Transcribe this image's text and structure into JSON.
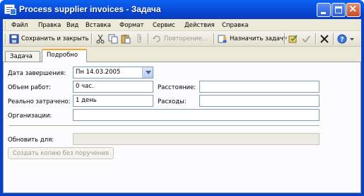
{
  "window": {
    "title": "Process supplier invoices - Задача"
  },
  "menu": [
    {
      "label": "Файл",
      "icon": ""
    },
    {
      "label": "Правка"
    },
    {
      "label": "Вид"
    },
    {
      "label": "Вставка"
    },
    {
      "label": "Формат"
    },
    {
      "label": "Сервис"
    },
    {
      "label": "Действия"
    },
    {
      "label": "Справка"
    }
  ],
  "toolbar": {
    "save_close": "Сохранить и закрыть",
    "recurrence": "Повторение...",
    "assign_task": "Назначить задачу",
    "icons": [
      "save-icon",
      "cut-icon",
      "copy-icon",
      "paste-icon",
      "paperclip-icon",
      "recurrence-icon",
      "assign-task-icon",
      "task-status-icon",
      "mark-complete-icon",
      "delete-icon",
      "help-icon"
    ]
  },
  "tabs": [
    {
      "label": "Задача",
      "active": false
    },
    {
      "label": "Подробно",
      "active": true
    }
  ],
  "details": {
    "completion_date_label": "Дата завершения:",
    "completion_date_value": "Пн 14.03.2005",
    "work_label": "Объем работ:",
    "work_value": "0 час.",
    "mileage_label": "Расстояние:",
    "mileage_value": "",
    "actual_work_label": "Реально затрачено:",
    "actual_work_value": "1 день",
    "billing_label": "Расходы:",
    "billing_value": "",
    "companies_label": "Организации:",
    "companies_value": "",
    "update_list_label": "Обновить для:",
    "update_list_value": "",
    "create_copy_button": "Создать копию без поручения"
  },
  "colors": {
    "titlebar": "#0a55e4",
    "face": "#ece9d8",
    "tab_highlight": "#f5a830"
  }
}
